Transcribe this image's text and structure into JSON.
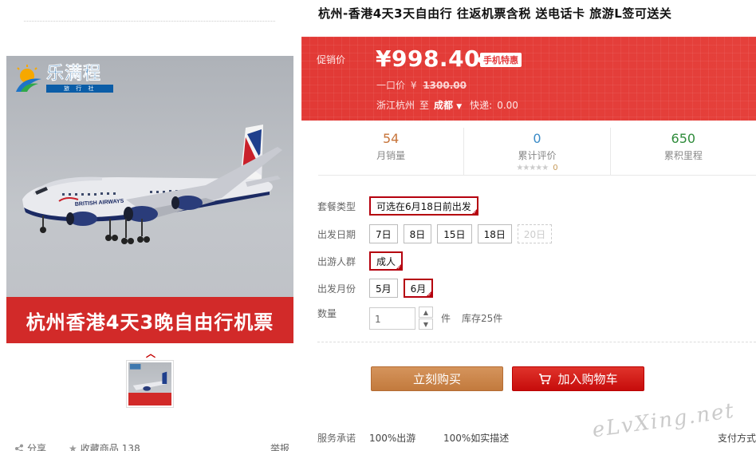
{
  "product": {
    "title": "杭州-香港4天3天自由行 往返机票含税 送电话卡 旅游L签可送关"
  },
  "gallery": {
    "brand_name": "乐满程",
    "brand_sub": "旅 行 社",
    "banner_text": "杭州香港4天3晚自由行机票",
    "airline_text": "BRITISH AIRWAYS",
    "thumb_up_icon": "chevron-up-icon"
  },
  "actions_bar": {
    "share_label": "分享",
    "favorite_label": "收藏商品",
    "favorite_count": "138",
    "report_label": "举报"
  },
  "price_box": {
    "promo_label": "促销价",
    "price": "¥998.40",
    "badge": "手机特惠",
    "orig_label": "一口价",
    "orig_currency": "¥",
    "orig_value": "1300.00",
    "from": "浙江杭州",
    "to_word": "至",
    "to_city": "成都",
    "express_label": "快递:",
    "express_value": "0.00"
  },
  "stats": {
    "monthly_sales": {
      "value": "54",
      "label": "月销量"
    },
    "reviews": {
      "value": "0",
      "label": "累计评价",
      "stars": "★★★★★",
      "star_count": "0"
    },
    "points": {
      "value": "650",
      "label": "累积里程"
    }
  },
  "options": {
    "package": {
      "label": "套餐类型",
      "items": [
        "可选在6月18日前出发"
      ],
      "selected": 0
    },
    "dates": {
      "label": "出发日期",
      "items": [
        "7日",
        "8日",
        "15日",
        "18日",
        "20日"
      ],
      "disabled": 4
    },
    "people": {
      "label": "出游人群",
      "items": [
        "成人"
      ],
      "selected": 0
    },
    "months": {
      "label": "出发月份",
      "items": [
        "5月",
        "6月"
      ],
      "selected": 1
    },
    "quantity": {
      "label": "数量",
      "value": "1",
      "unit": "件",
      "stock": "库存25件"
    }
  },
  "buttons": {
    "buy_now": "立刻购买",
    "add_to_cart": "加入购物车"
  },
  "service": {
    "label": "服务承诺",
    "item1": "100%出游",
    "item2": "100%如实描述",
    "payment": "支付方式"
  },
  "watermark": "eLvXing.net",
  "colors": {
    "accent_red": "#e4393c",
    "buy_button": "#c98445",
    "cart_button": "#c60c0b",
    "selected_border": "#b5000e",
    "brand_blue": "#0b5da7"
  }
}
